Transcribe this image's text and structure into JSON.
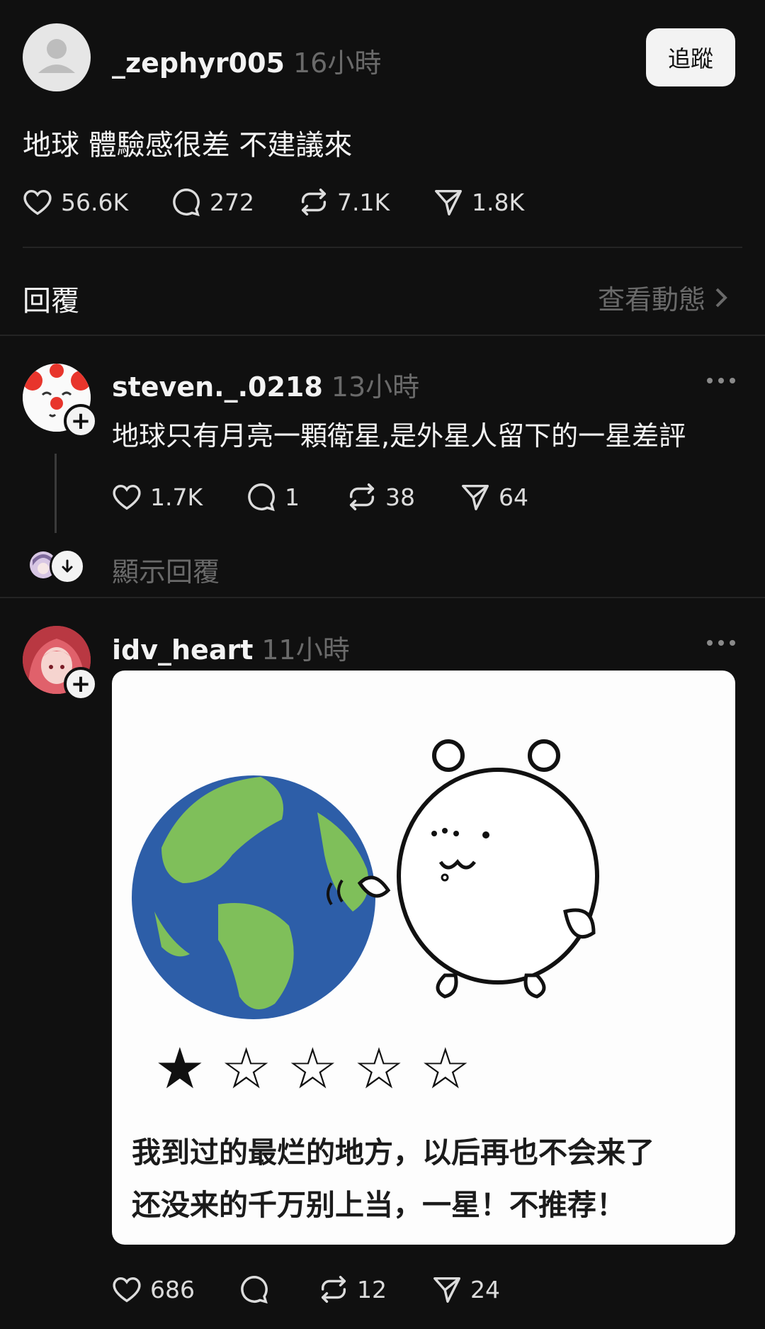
{
  "post": {
    "username": "_zephyr005",
    "time": "16小時",
    "follow_label": "追蹤",
    "text": "地球 體驗感很差 不建議來",
    "likes": "56.6K",
    "comments": "272",
    "reposts": "7.1K",
    "shares": "1.8K"
  },
  "replies_bar": {
    "label": "回覆",
    "activity_label": "查看動態"
  },
  "reply1": {
    "username": "steven._.0218",
    "time": "13小時",
    "text": "地球只有月亮一顆衛星,是外星人留下的一星差評",
    "likes": "1.7K",
    "comments": "1",
    "reposts": "38",
    "shares": "64",
    "show_replies": "顯示回覆"
  },
  "reply2": {
    "username": "idv_heart",
    "time": "11小時",
    "likes": "686",
    "reposts": "12",
    "shares": "24",
    "image": {
      "rating": {
        "value": 1,
        "max": 5
      },
      "caption_line1": "我到过的最烂的地方，以后再也不会来了",
      "caption_line2": "还没来的千万别上当，一星！不推荐！"
    }
  },
  "colors": {
    "background": "#101010",
    "text": "#f3f3f3",
    "muted": "#6f6f6f",
    "divider": "#242424",
    "follow_button_bg": "#f3f3f3"
  },
  "icons": [
    "heart-icon",
    "comment-icon",
    "repost-icon",
    "share-icon",
    "chevron-right-icon",
    "more-icon",
    "plus-icon",
    "arrow-down-icon",
    "person-icon"
  ]
}
